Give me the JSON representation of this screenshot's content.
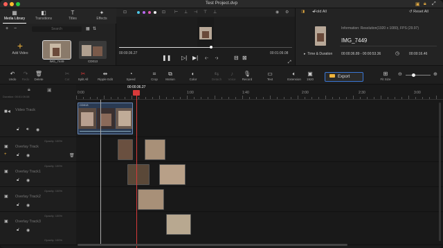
{
  "window": {
    "title": "Test Project.dvp"
  },
  "media_panel": {
    "tabs": [
      {
        "label": "Media Library",
        "icon": "film-icon"
      },
      {
        "label": "Transitions",
        "icon": "transition-icon"
      },
      {
        "label": "Titles",
        "icon": "titles-icon"
      },
      {
        "label": "Effects",
        "icon": "effects-icon"
      }
    ],
    "search_placeholder": "Search",
    "add_video_label": "Add Video",
    "items": [
      {
        "name": "IMG_7449"
      },
      {
        "name": "CD013"
      }
    ]
  },
  "preview": {
    "current_time": "00:00:36.27",
    "total_time": "00:01:09.08",
    "progress": 0.53
  },
  "info_panel": {
    "fold_all": "Fold All",
    "reset_all": "Reset All",
    "information": "Information: Resolution(1920 x 1080), FPS (29.97)",
    "clip_name": "IMG_7449",
    "section": "Time & Duration",
    "time_range": "00:00:36.89 - 00:00:53.36",
    "duration": "00:00:16.46"
  },
  "toolbar": {
    "tools": [
      "Undo",
      "Redo",
      "Delete",
      "Cut",
      "Split All",
      "Ripple Edit",
      "Speed",
      "Crop",
      "Motion",
      "Color",
      "Detach",
      "Voice",
      "Record",
      "Text",
      "Extension",
      "1920"
    ],
    "export_label": "Export",
    "fit_label": "Fit Size"
  },
  "timeline": {
    "playhead_time": "00:00:36.27",
    "duration_label": "Duration: 00:01:09.08",
    "ruler_labels": [
      "0:00",
      "1:00",
      "1:40",
      "2:00",
      "2:30",
      "3:00"
    ],
    "video_track": {
      "name": "Video Track",
      "clip_name": "CD013"
    },
    "overlay_tracks": [
      {
        "name": "Overlay Track",
        "opacity": "Opacity: 100%"
      },
      {
        "name": "Overlay Track1",
        "opacity": "Opacity: 100%"
      },
      {
        "name": "Overlay Track2",
        "opacity": "Opacity: 100%"
      },
      {
        "name": "Overlay Track3",
        "opacity": "Opacity: 100%"
      }
    ],
    "video_opacity": "Opacity: 100%"
  },
  "colors": {
    "accent": "#f0b43c",
    "playhead": "#d83a3a",
    "export_border": "#3a78d6"
  }
}
